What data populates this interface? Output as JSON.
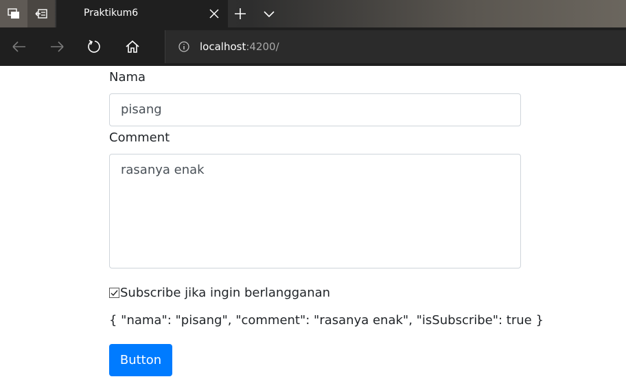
{
  "browser": {
    "tab_title": "Praktikum6",
    "url_host": "localhost",
    "url_port": ":4200/"
  },
  "form": {
    "nama_label": "Nama",
    "nama_value": "pisang",
    "comment_label": "Comment",
    "comment_value": "rasanya enak",
    "subscribe_label": "Subscribe jika ingin berlangganan",
    "subscribe_checked": true,
    "json_output": "{ \"nama\": \"pisang\", \"comment\": \"rasanya enak\", \"isSubscribe\": true }",
    "button_label": "Button"
  },
  "colors": {
    "primary": "#007bff",
    "chrome_dark": "#1f1f1f"
  }
}
